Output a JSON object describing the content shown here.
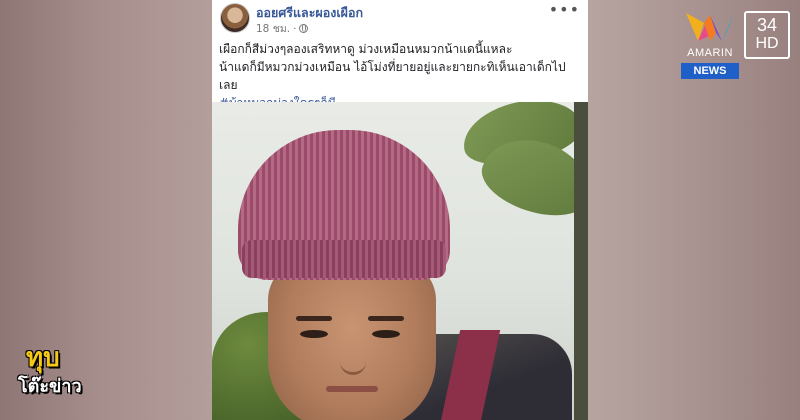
{
  "post": {
    "page_name": "ออยศรีและผองเผือก",
    "time": "18 ชม.",
    "more_label": "•••",
    "text_line1": "เผือกก็สีม่วงๆลองเสริทหาดู ม่วงเหมือนหมวกน้าแดนี้แหละ",
    "text_line2": "น้าแดก็มีหมวกม่วงเหมือน ไอ้โม่งที่ยายอยู่และยายกะทิเห็นเอาเด็กไปเลย",
    "hashtag": "#บ้าหมวกม่วงใครๆก็มี"
  },
  "branding": {
    "network_name": "AMARIN",
    "network_news": "NEWS",
    "channel_number": "34",
    "channel_hd": "HD",
    "show_line1": "ทุบ",
    "show_line2": "โต๊ะข่าว"
  },
  "colors": {
    "link": "#385898",
    "news_badge": "#1f5fc8",
    "show_logo": "#f6c915"
  }
}
